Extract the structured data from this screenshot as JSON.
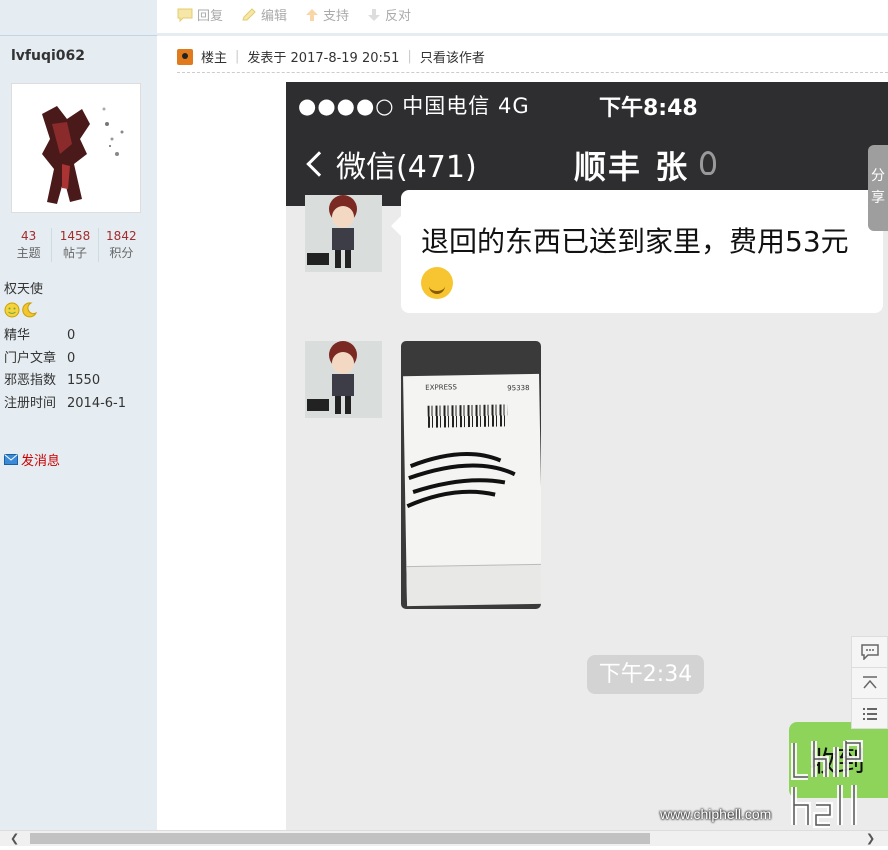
{
  "actions": [
    {
      "label": "回复",
      "icon": "reply-icon"
    },
    {
      "label": "编辑",
      "icon": "edit-icon"
    },
    {
      "label": "支持",
      "icon": "up-arrow-icon"
    },
    {
      "label": "反对",
      "icon": "down-arrow-icon"
    }
  ],
  "user": {
    "name": "lvfuqi062",
    "stats": [
      {
        "num": "43",
        "label": "主题"
      },
      {
        "num": "1458",
        "label": "帖子"
      },
      {
        "num": "1842",
        "label": "积分"
      }
    ],
    "rank": "权天使",
    "info": [
      {
        "k": "精华",
        "v": "0"
      },
      {
        "k": "门户文章",
        "v": "0"
      },
      {
        "k": "邪恶指数",
        "v": "1550"
      },
      {
        "k": "注册时间",
        "v": "2014-6-1"
      }
    ],
    "message_link": "发消息"
  },
  "post": {
    "role": "楼主",
    "posted": "发表于 2017-8-19 20:51",
    "only_author": "只看该作者"
  },
  "phone": {
    "status_left": "●●●●○ 中国电信  4G",
    "time": "下午8:48",
    "back_label": "微信(471)",
    "chat_title": "顺丰 张",
    "message_text": "退回的东西已送到家里，费用53元",
    "photo_brand": "EXPRESS",
    "photo_number": "95338",
    "time_label": "下午2:34",
    "green_text": "收到"
  },
  "share_tab": "分享",
  "watermark": {
    "logo": "chip hell",
    "url": "www.chiphell.com"
  },
  "colors": {
    "sidebar_bg": "#e5edf2",
    "stat_num": "#a32c2c",
    "phone_header": "#2e2e30",
    "chat_bg": "#ebebeb",
    "green_bubble": "#8fd45a"
  }
}
